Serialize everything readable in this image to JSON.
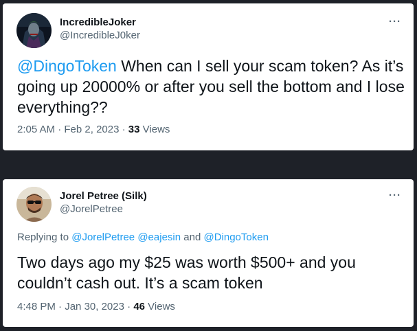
{
  "tweet1": {
    "display_name": "IncredibleJoker",
    "handle": "@IncredibleJ0ker",
    "more": "···",
    "mention": "@DingoToken",
    "text": " When can I sell your scam token? As it’s going up 20000% or after you sell the bottom and I lose everything??",
    "time": "2:05 AM",
    "date": "Feb 2, 2023",
    "sep": "·",
    "views_count": "33",
    "views_label": "Views"
  },
  "tweet2": {
    "display_name": "Jorel Petree (Silk)",
    "handle": "@JorelPetree",
    "more": "···",
    "replying_prefix": "Replying to ",
    "replying_mention1": "@JorelPetree",
    "replying_mention2": "@eajesin",
    "replying_and": " and ",
    "replying_mention3": "@DingoToken",
    "text": "Two days ago my $25 was worth $500+ and you couldn’t cash out. It’s a scam token",
    "time": "4:48 PM",
    "date": "Jan 30, 2023",
    "sep": "·",
    "views_count": "46",
    "views_label": "Views"
  },
  "colors": {
    "background": "#1e2128",
    "card": "#ffffff",
    "text": "#0f1419",
    "muted": "#536471",
    "link": "#1d9bf0"
  }
}
